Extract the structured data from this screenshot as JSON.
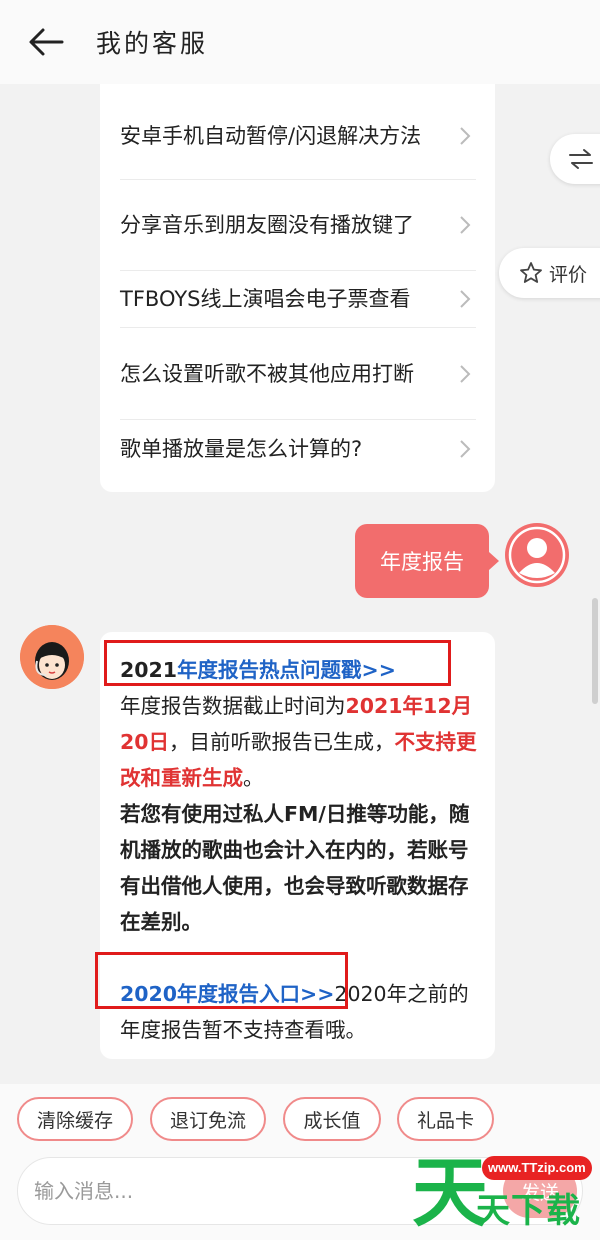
{
  "header": {
    "title": "我的客服"
  },
  "faq": {
    "items": [
      {
        "label": "安卓手机自动暂停/闪退解决方法"
      },
      {
        "label": "分享音乐到朋友圈没有播放键了"
      },
      {
        "label": "TFBOYS线上演唱会电子票查看"
      },
      {
        "label": "怎么设置听歌不被其他应用打断"
      },
      {
        "label": "歌单播放量是怎么计算的?"
      }
    ]
  },
  "float_buttons": {
    "switch_icon": "swap-arrows-icon",
    "rate_label": "评价",
    "rate_icon": "star-outline-icon"
  },
  "user_message": {
    "text": "年度报告"
  },
  "bot_message": {
    "year_2021": "2021",
    "link_2021": "年度报告热点问题戳>>",
    "p1_a": "年度报告数据截止时间为",
    "p1_date": "2021年12月20日",
    "p1_b": "，目前听歌报告已生成，",
    "p1_red": "不支持更改和重新生成",
    "p1_end": "。",
    "p2_bold": "若您有使用过私人FM/日推等功能，随机播放的歌曲也会计入在内的，若账号有出借他人使用，也会导致听歌数据存在差别。",
    "link_2020": "2020年度报告入口>>",
    "p3": "2020年之前的年度报告暂不支持查看哦。"
  },
  "quick_actions": [
    {
      "label": "清除缓存"
    },
    {
      "label": "退订免流"
    },
    {
      "label": "成长值"
    },
    {
      "label": "礼品卡"
    }
  ],
  "composer": {
    "placeholder": "输入消息...",
    "send_label": "发送"
  },
  "watermark": {
    "url": "www.TTzip.com",
    "big": "天",
    "small": "天下载"
  },
  "colors": {
    "accent_red": "#f26d6d",
    "link_blue": "#1f63c6",
    "highlight_red": "#e03333",
    "annotation_box": "#e01b1b"
  }
}
